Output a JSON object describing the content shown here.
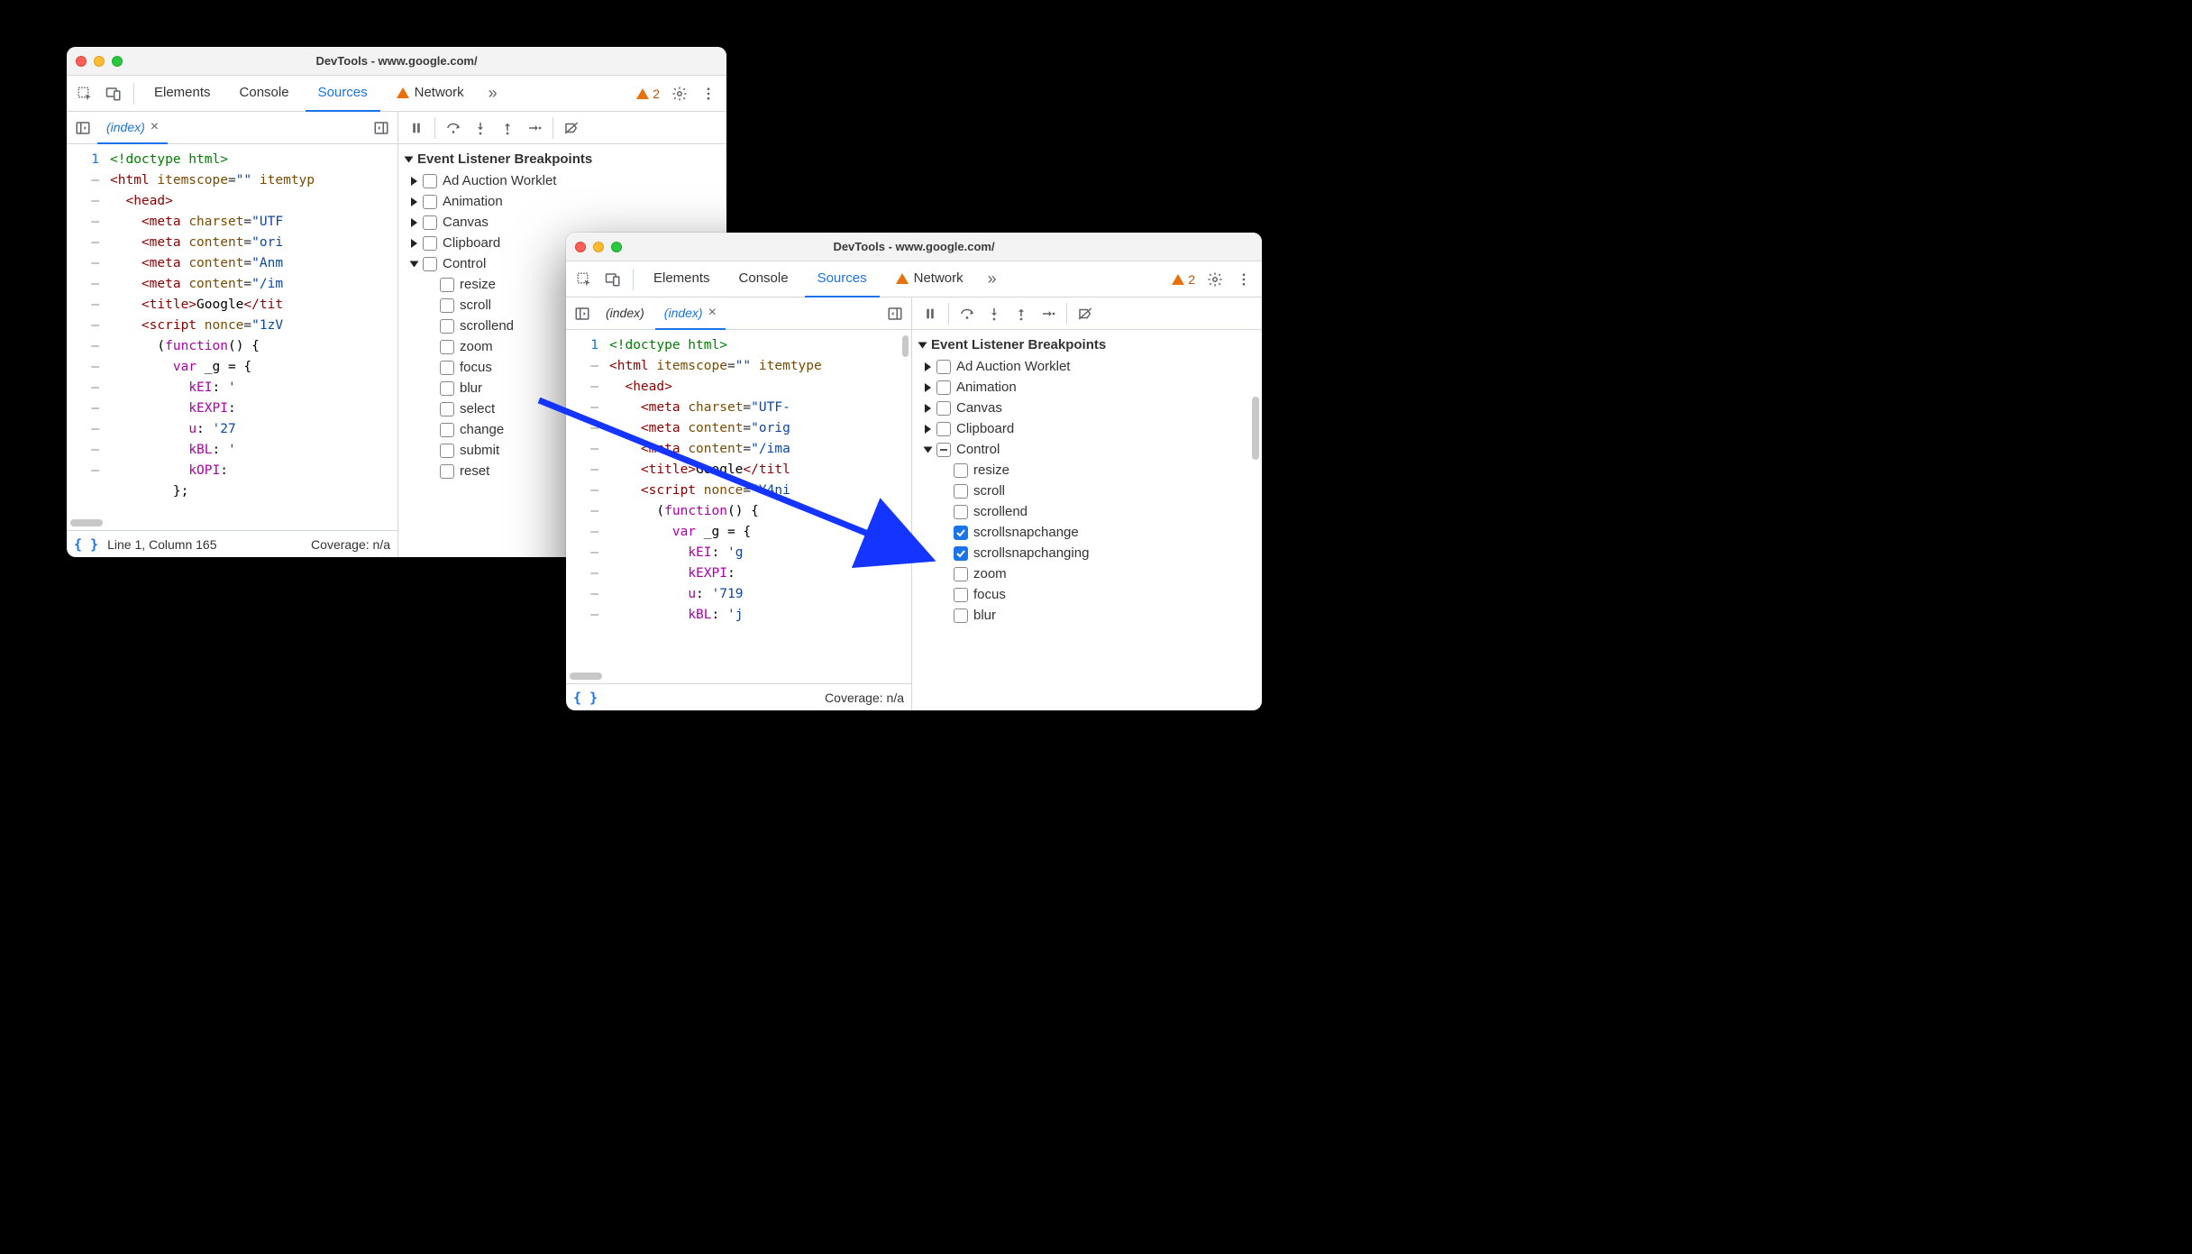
{
  "windows": {
    "left": {
      "title": "DevTools - www.google.com/",
      "tabs": {
        "elements": "Elements",
        "console": "Console",
        "sources": "Sources",
        "network": "Network"
      },
      "more_count": 2,
      "file_tabs": [
        {
          "name": "(index)",
          "active": true
        }
      ],
      "gutter": [
        "1",
        "—",
        "—",
        "—",
        "—",
        "—",
        "—",
        "—",
        "—",
        "—",
        "—",
        "—",
        "—",
        "—",
        "—",
        "—"
      ],
      "status": {
        "pos": "Line 1, Column 165",
        "coverage": "Coverage: n/a"
      },
      "bp_header": "Event Listener Breakpoints",
      "bp_groups": [
        {
          "label": "Ad Auction Worklet",
          "open": false
        },
        {
          "label": "Animation",
          "open": false
        },
        {
          "label": "Canvas",
          "open": false
        },
        {
          "label": "Clipboard",
          "open": false
        },
        {
          "label": "Control",
          "open": true,
          "items": [
            {
              "label": "resize",
              "checked": false
            },
            {
              "label": "scroll",
              "checked": false
            },
            {
              "label": "scrollend",
              "checked": false
            },
            {
              "label": "zoom",
              "checked": false
            },
            {
              "label": "focus",
              "checked": false
            },
            {
              "label": "blur",
              "checked": false
            },
            {
              "label": "select",
              "checked": false
            },
            {
              "label": "change",
              "checked": false
            },
            {
              "label": "submit",
              "checked": false
            },
            {
              "label": "reset",
              "checked": false
            }
          ]
        }
      ]
    },
    "right": {
      "title": "DevTools - www.google.com/",
      "tabs": {
        "elements": "Elements",
        "console": "Console",
        "sources": "Sources",
        "network": "Network"
      },
      "more_count": 2,
      "file_tabs": [
        {
          "name": "(index)",
          "active": false
        },
        {
          "name": "(index)",
          "active": true
        }
      ],
      "gutter": [
        "1",
        "—",
        "—",
        "—",
        "—",
        "—",
        "—",
        "—",
        "—",
        "—",
        "—",
        "—",
        "—",
        "—"
      ],
      "status": {
        "coverage": "Coverage: n/a"
      },
      "bp_header": "Event Listener Breakpoints",
      "bp_groups": [
        {
          "label": "Ad Auction Worklet",
          "open": false
        },
        {
          "label": "Animation",
          "open": false
        },
        {
          "label": "Canvas",
          "open": false
        },
        {
          "label": "Clipboard",
          "open": false
        },
        {
          "label": "Control",
          "open": true,
          "dash": true,
          "items": [
            {
              "label": "resize",
              "checked": false
            },
            {
              "label": "scroll",
              "checked": false
            },
            {
              "label": "scrollend",
              "checked": false
            },
            {
              "label": "scrollsnapchange",
              "checked": true
            },
            {
              "label": "scrollsnapchanging",
              "checked": true
            },
            {
              "label": "zoom",
              "checked": false
            },
            {
              "label": "focus",
              "checked": false
            },
            {
              "label": "blur",
              "checked": false
            }
          ]
        }
      ]
    }
  },
  "code_left": [
    "<span class='c-comm'>&lt;!doctype html&gt;</span>",
    "<span class='c-tag'>&lt;html</span> <span class='c-attr'>itemscope</span>=<span class='c-str'>\"\"</span> <span class='c-attr'>itemtyp</span>",
    "  <span class='c-tag'>&lt;head&gt;</span>",
    "    <span class='c-tag'>&lt;meta</span> <span class='c-attr'>charset</span>=<span class='c-str'>\"UTF</span>",
    "    <span class='c-tag'>&lt;meta</span> <span class='c-attr'>content</span>=<span class='c-str'>\"ori</span>",
    "    <span class='c-tag'>&lt;meta</span> <span class='c-attr'>content</span>=<span class='c-str'>\"Anm</span>",
    "    <span class='c-tag'>&lt;meta</span> <span class='c-attr'>content</span>=<span class='c-str'>\"/im</span>",
    "    <span class='c-tag'>&lt;title&gt;</span><span class='c-plain'>Google</span><span class='c-tag'>&lt;/tit</span>",
    "    <span class='c-tag'>&lt;script</span> <span class='c-attr'>nonce</span>=<span class='c-str'>\"1zV</span>",
    "      <span class='c-plain'>(</span><span class='c-kw'>function</span><span class='c-plain'>() {</span>",
    "        <span class='c-kw'>var</span> <span class='c-plain'>_g = {</span>",
    "          <span class='c-prop'>kEI</span><span class='c-plain'>: </span><span class='c-str'>'</span>",
    "          <span class='c-prop'>kEXPI</span><span class='c-plain'>:</span>",
    "          <span class='c-prop'>u</span><span class='c-plain'>: </span><span class='c-str'>'27</span>",
    "          <span class='c-prop'>kBL</span><span class='c-plain'>: </span><span class='c-str'>'</span>",
    "          <span class='c-prop'>kOPI</span><span class='c-plain'>:</span>",
    "        <span class='c-plain'>};</span>"
  ],
  "code_right": [
    "<span class='c-comm'>&lt;!doctype html&gt;</span>",
    "<span class='c-tag'>&lt;html</span> <span class='c-attr'>itemscope</span>=<span class='c-str'>\"\"</span> <span class='c-attr'>itemtype</span>",
    "  <span class='c-tag'>&lt;head&gt;</span>",
    "    <span class='c-tag'>&lt;meta</span> <span class='c-attr'>charset</span>=<span class='c-str'>\"UTF-</span>",
    "    <span class='c-tag'>&lt;meta</span> <span class='c-attr'>content</span>=<span class='c-str'>\"orig</span>",
    "    <span class='c-tag'>&lt;meta</span> <span class='c-attr'>content</span>=<span class='c-str'>\"/ima</span>",
    "    <span class='c-tag'>&lt;title&gt;</span><span class='c-plain'>Google</span><span class='c-tag'>&lt;/titl</span>",
    "    <span class='c-tag'>&lt;script</span> <span class='c-attr'>nonce</span>=<span class='c-str'>\"Y4ni</span>",
    "      <span class='c-plain'>(</span><span class='c-kw'>function</span><span class='c-plain'>() {</span>",
    "        <span class='c-kw'>var</span> <span class='c-plain'>_g = {</span>",
    "          <span class='c-prop'>kEI</span><span class='c-plain'>: </span><span class='c-str'>'g</span>",
    "          <span class='c-prop'>kEXPI</span><span class='c-plain'>:</span>",
    "          <span class='c-prop'>u</span><span class='c-plain'>: </span><span class='c-str'>'719</span>",
    "          <span class='c-prop'>kBL</span><span class='c-plain'>: </span><span class='c-str'>'j</span>"
  ]
}
